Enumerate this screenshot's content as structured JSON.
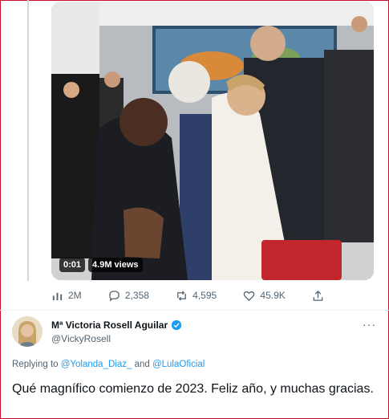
{
  "video": {
    "time": "0:01",
    "views": "4.9M views"
  },
  "actions": {
    "views": "2M",
    "replies": "2,358",
    "retweets": "4,595",
    "likes": "45.9K"
  },
  "author": {
    "name": "Mª Victoria Rosell Aguilar",
    "handle": "@VickyRosell",
    "more_label": "···"
  },
  "reply": {
    "prefix": "Replying to",
    "mention1": "@Yolanda_Diaz_",
    "joiner": "and",
    "mention2": "@LulaOficial"
  },
  "tweet": {
    "text": "Qué magnífico comienzo de 2023. Feliz año, y muchas gracias."
  },
  "colors": {
    "accent": "#1d9bf0",
    "muted": "#536471",
    "frame": "#c8102e"
  }
}
